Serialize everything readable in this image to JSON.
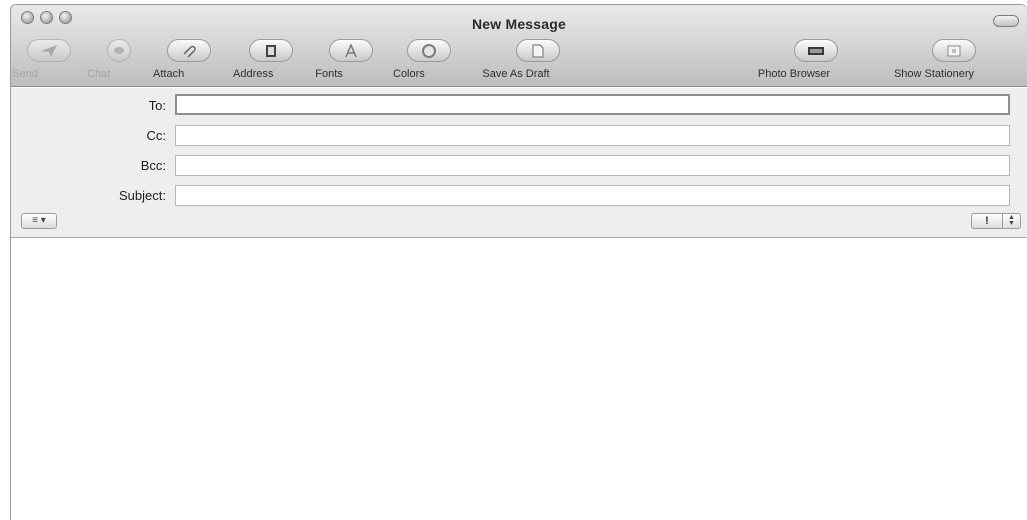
{
  "window": {
    "title": "New Message"
  },
  "toolbar": {
    "send": "Send",
    "chat": "Chat",
    "attach": "Attach",
    "address": "Address",
    "fonts": "Fonts",
    "colors": "Colors",
    "save_as_draft": "Save As Draft",
    "photo_browser": "Photo Browser",
    "show_stationery": "Show Stationery"
  },
  "headers": {
    "to_label": "To:",
    "cc_label": "Cc:",
    "bcc_label": "Bcc:",
    "subject_label": "Subject:",
    "to_value": "",
    "cc_value": "",
    "bcc_value": "",
    "subject_value": ""
  },
  "format_popup": {
    "label": "≡ ▾"
  },
  "priority": {
    "label": "!"
  },
  "message_body": {
    "value": ""
  }
}
